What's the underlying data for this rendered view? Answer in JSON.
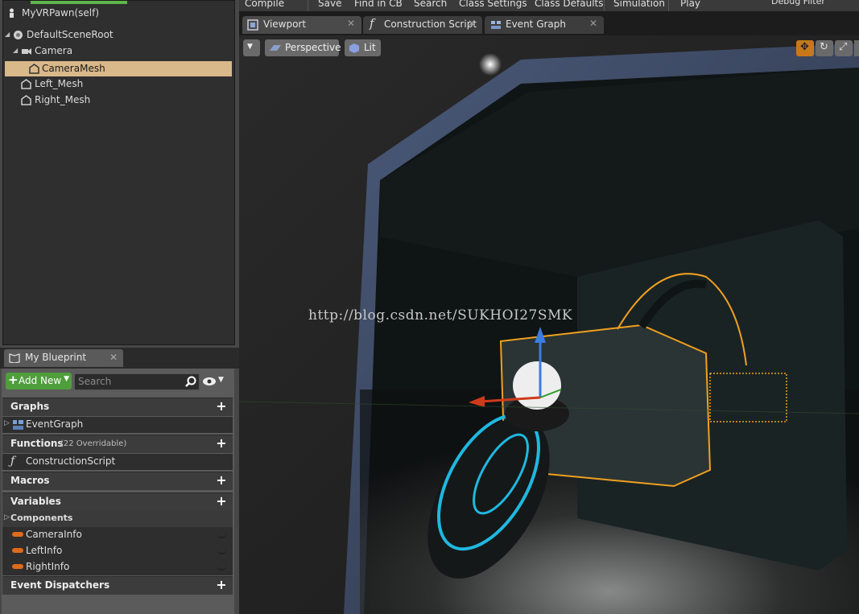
{
  "toolbar": {
    "compile": "Compile",
    "save": "Save",
    "find_in_cb": "Find in CB",
    "search": "Search",
    "class_settings": "Class Settings",
    "class_defaults": "Class Defaults",
    "simulation": "Simulation",
    "play": "Play",
    "debug_filter": "Debug Filter"
  },
  "components": {
    "root_label": "MyVRPawn(self)",
    "items": [
      {
        "label": "DefaultSceneRoot",
        "icon": "scene-root-icon"
      },
      {
        "label": "Camera",
        "icon": "camera-icon"
      },
      {
        "label": "CameraMesh",
        "icon": "mesh-icon",
        "selected": true
      },
      {
        "label": "Left_Mesh",
        "icon": "mesh-icon"
      },
      {
        "label": "Right_Mesh",
        "icon": "mesh-icon"
      }
    ]
  },
  "my_blueprint": {
    "tab_label": "My Blueprint",
    "add_new": "Add New",
    "search_placeholder": "Search",
    "sections": {
      "graphs": "Graphs",
      "functions": "Functions",
      "functions_note": "(22 Overridable)",
      "macros": "Macros",
      "variables": "Variables",
      "event_dispatchers": "Event Dispatchers"
    },
    "graph_items": [
      "EventGraph"
    ],
    "function_items": [
      "ConstructionScript"
    ],
    "variable_category": "Components",
    "variable_items": [
      "CameraInfo",
      "LeftInfo",
      "RightInfo"
    ]
  },
  "editor_tabs": [
    "Viewport",
    "Construction Script",
    "Event Graph"
  ],
  "viewport": {
    "perspective_label": "Perspective",
    "lit_label": "Lit",
    "watermark": "http://blog.csdn.net/SUKHOI27SMK"
  },
  "colors": {
    "selection": "#d9b88a",
    "accent_green": "#5fb54a",
    "variable_pill": "#e06a1a",
    "outline_orange": "#f0a020",
    "ring_cyan": "#1fb8e0"
  }
}
